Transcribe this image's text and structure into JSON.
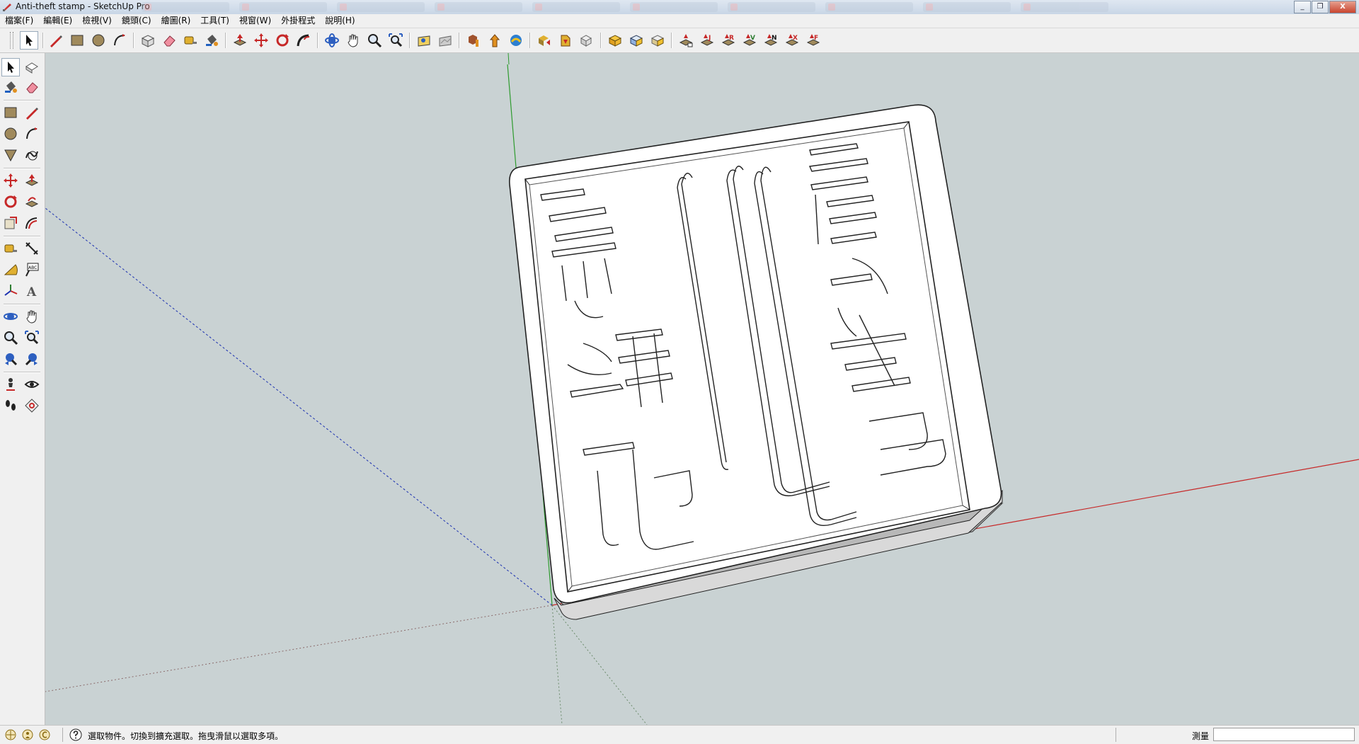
{
  "window": {
    "title": "Anti-theft stamp - SketchUp Pro",
    "controls": {
      "minimize": "_",
      "restore": "❐",
      "close": "X"
    }
  },
  "background_tabs": [
    "",
    "",
    "",
    "",
    "",
    "",
    "",
    "",
    "",
    ""
  ],
  "menu": [
    "檔案(F)",
    "編輯(E)",
    "檢視(V)",
    "鏡頭(C)",
    "繪圖(R)",
    "工具(T)",
    "視窗(W)",
    "外掛程式",
    "說明(H)"
  ],
  "toolbar": {
    "items": [
      "select-tool",
      "line-tool",
      "rectangle-tool",
      "circle-tool",
      "arc-tool",
      "make-component-tool",
      "eraser-tool",
      "tape-measure-tool",
      "paint-bucket-tool",
      "push-pull-tool",
      "move-tool",
      "rotate-tool",
      "follow-me-tool",
      "orbit-tool",
      "pan-tool",
      "zoom-tool",
      "zoom-extents-tool",
      "add-location-tool",
      "toggle-terrain-tool",
      "get-models-tool",
      "share-model-tool",
      "share-component-tool",
      "extension-warehouse-tool",
      "send-to-layout-tool",
      "extension-manager-tool",
      "solid-union-tool",
      "solid-intersect-tool",
      "solid-trim-tool",
      "sandbox-from-contours",
      "sandbox-from-scratch",
      "sandbox-smoove",
      "sandbox-stamp",
      "sandbox-drape",
      "sandbox-add-detail",
      "sandbox-flip-edge"
    ]
  },
  "sandbox_labels": [
    "J",
    "R",
    "V",
    "N",
    "X",
    "F"
  ],
  "left_toolbar": {
    "items": [
      "select-tool",
      "make-component-tool",
      "paint-bucket-tool",
      "eraser-tool",
      "rectangle-tool",
      "line-tool",
      "circle-tool",
      "arc-tool",
      "polygon-tool",
      "freehand-tool",
      "move-tool",
      "push-pull-tool",
      "rotate-tool",
      "follow-me-tool",
      "scale-tool",
      "offset-tool",
      "tape-measure-tool",
      "dimension-tool",
      "protractor-tool",
      "text-tool",
      "axes-tool",
      "3d-text-tool",
      "orbit-tool",
      "pan-tool",
      "zoom-tool",
      "zoom-window-tool",
      "previous-view-tool",
      "next-view-tool",
      "position-camera-tool",
      "look-around-tool",
      "walk-tool",
      "section-plane-tool"
    ],
    "text_tool_glyph": "ABC",
    "text3d_glyph": "A"
  },
  "model": {
    "name": "Anti-theft stamp",
    "colors": {
      "face": "#ffffff",
      "shadow": "#cfcfcf",
      "side": "#d9d9d9",
      "edge": "#222222"
    }
  },
  "axes": {
    "colors": {
      "red": "#c62828",
      "green": "#2e9b2e",
      "blue": "#1a2fb0"
    }
  },
  "status": {
    "hint": "選取物件。切換到擴充選取。拖曳滑鼠以選取多項。",
    "measure_label": "測量",
    "measure_value": ""
  }
}
